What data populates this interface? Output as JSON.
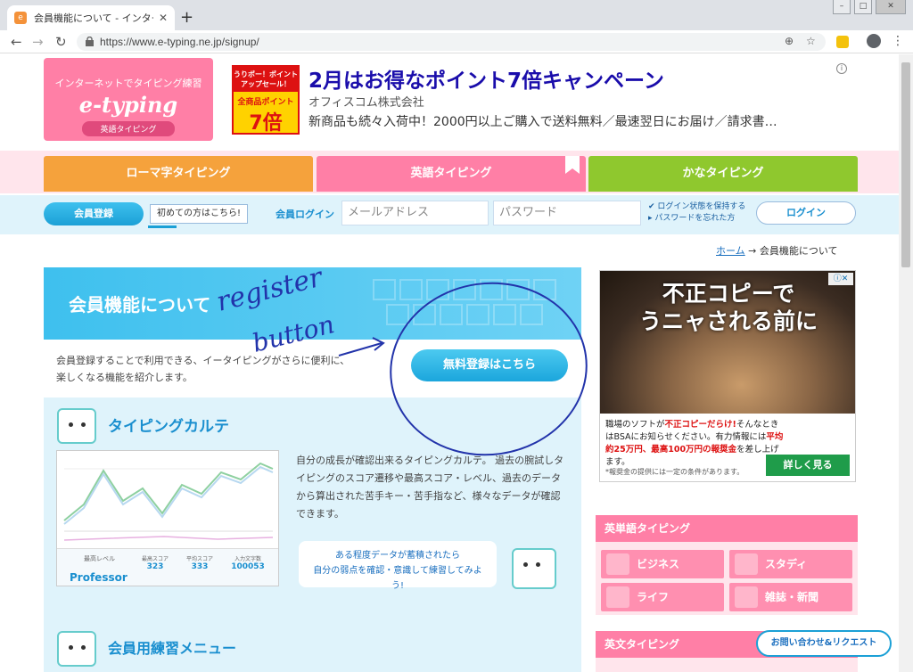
{
  "browser": {
    "tab_title": "会員機能について - インターネ",
    "url": "https://www.e-typing.ne.jp/signup/"
  },
  "header": {
    "logo_tagline": "インターネットでタイピング練習",
    "logo_name": "e-typing",
    "logo_sub": "英語タイピング",
    "ad": {
      "banner_line1": "うりポー！ポイントアップセール！",
      "banner_line2": "全商品ポイント",
      "banner_line3": "7倍",
      "title": "2月はお得なポイント7倍キャンペーン",
      "company": "オフィスコム株式会社",
      "description": "新商品も続々入荷中！2000円以上ご購入で送料無料／最速翌日にお届け／請求書…"
    }
  },
  "nav": {
    "romaji": "ローマ字タイピング",
    "eigo": "英語タイピング",
    "kana": "かなタイピング"
  },
  "login": {
    "register_label": "会員登録",
    "first_time": "初めての方はこちら!",
    "login_label": "会員ログイン",
    "email_placeholder": "メールアドレス",
    "password_placeholder": "パスワード",
    "keep_login": "ログイン状態を保持する",
    "forgot_password": "パスワードを忘れた方",
    "login_button": "ログイン"
  },
  "breadcrumb": {
    "home": "ホーム",
    "separator": "→",
    "current": "会員機能について"
  },
  "feature": {
    "title": "会員機能について",
    "text_line1": "会員登録することで利用できる、イータイピングがさらに便利に、",
    "text_line2": "楽しくなる機能を紹介します。",
    "free_button": "無料登録はこちら"
  },
  "annotation": {
    "word1": "register",
    "word2": "button"
  },
  "karte": {
    "title": "タイピングカルテ",
    "description": "自分の成長が確認出来るタイピングカルテ。 過去の腕試しタイピングのスコア遷移や最高スコア・レベル、過去のデータから算出された苦手キー・苦手指など、様々なデータが確認できます。",
    "bubble_line1": "ある程度データが蓄積されたら",
    "bubble_line2": "自分の弱点を確認・意識して練習してみよう!",
    "level_label": "最高レベル",
    "level_value": "Professor",
    "stats": [
      {
        "label": "最高スコア",
        "value": "323"
      },
      {
        "label": "平均スコア",
        "value": "333"
      },
      {
        "label": "入力文字数",
        "value": "100053"
      }
    ]
  },
  "menu": {
    "title": "会員用練習メニュー"
  },
  "side_ad": {
    "headline_line1": "不正コピーで",
    "headline_line2": "うニャされる前に",
    "copy_part1": "職場のソフトが",
    "copy_red1": "不正コピーだらけ!",
    "copy_part2": "そんなときはBSAにお知らせください。有力情報には",
    "copy_red2": "平均約25万円、最高100万円の報奨金",
    "copy_part3": "を差し上げます。",
    "note": "*報奨金の提供には一定の条件があります。",
    "button": "詳しく見る"
  },
  "side_words": {
    "title": "英単語タイピング",
    "items": [
      "ビジネス",
      "スタディ",
      "ライフ",
      "雑誌・新聞"
    ]
  },
  "side_sentences": {
    "title": "英文タイピング"
  },
  "contact_button": "お問い合わせ&リクエスト"
}
